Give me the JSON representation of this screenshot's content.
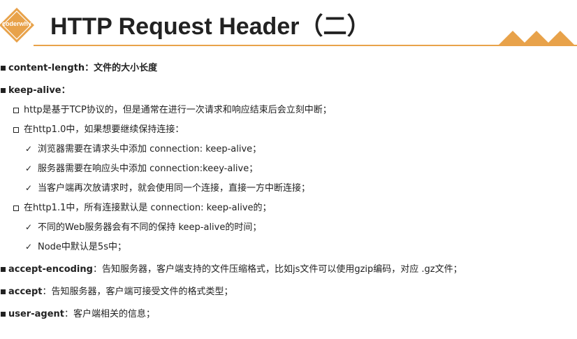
{
  "header": {
    "logo_text": "coderwhy",
    "title": "HTTP Request Header（二）",
    "accent_color": "#e8a24a"
  },
  "items": {
    "content_length": {
      "key": "content-length：",
      "desc": "文件的大小长度"
    },
    "keep_alive": {
      "key": "keep-alive：",
      "sub1": "http是基于TCP协议的，但是通常在进行一次请求和响应结束后会立刻中断；",
      "sub2": "在http1.0中，如果想要继续保持连接：",
      "sub2_items": [
        "浏览器需要在请求头中添加 connection: keep-alive；",
        "服务器需要在响应头中添加 connection:keey-alive；",
        "当客户端再次放请求时，就会使用同一个连接，直接一方中断连接；"
      ],
      "sub3": "在http1.1中，所有连接默认是 connection: keep-alive的；",
      "sub3_items": [
        "不同的Web服务器会有不同的保持 keep-alive的时间；",
        "Node中默认是5s中；"
      ]
    },
    "accept_encoding": {
      "key": "accept-encoding",
      "desc": "：告知服务器，客户端支持的文件压缩格式，比如js文件可以使用gzip编码，对应 .gz文件；"
    },
    "accept": {
      "key": "accept",
      "desc": "：告知服务器，客户端可接受文件的格式类型；"
    },
    "user_agent": {
      "key": "user-agent",
      "desc": "：客户端相关的信息；"
    }
  },
  "icons": {
    "check": "✓"
  }
}
